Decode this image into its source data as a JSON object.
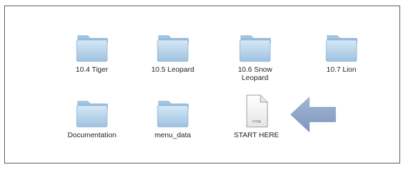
{
  "finder": {
    "items": [
      {
        "label": "10.4 Tiger",
        "kind": "folder",
        "icon": "folder-icon"
      },
      {
        "label": "10.5 Leopard",
        "kind": "folder",
        "icon": "folder-icon"
      },
      {
        "label": "10.6 Snow Leopard",
        "kind": "folder",
        "icon": "folder-icon"
      },
      {
        "label": "10.7 Lion",
        "kind": "folder",
        "icon": "folder-icon"
      },
      {
        "label": "Documentation",
        "kind": "folder",
        "icon": "folder-icon"
      },
      {
        "label": "menu_data",
        "kind": "folder",
        "icon": "folder-icon"
      },
      {
        "label": "START HERE",
        "kind": "html-file",
        "icon": "html-file-icon",
        "badge": "HTML"
      }
    ],
    "pointer": {
      "icon": "left-arrow-icon",
      "color": "#8aa2c4"
    }
  },
  "colors": {
    "folder_light": "#cfe3f3",
    "folder_dark": "#8fb6d9",
    "window_border": "#5a5a5a"
  }
}
